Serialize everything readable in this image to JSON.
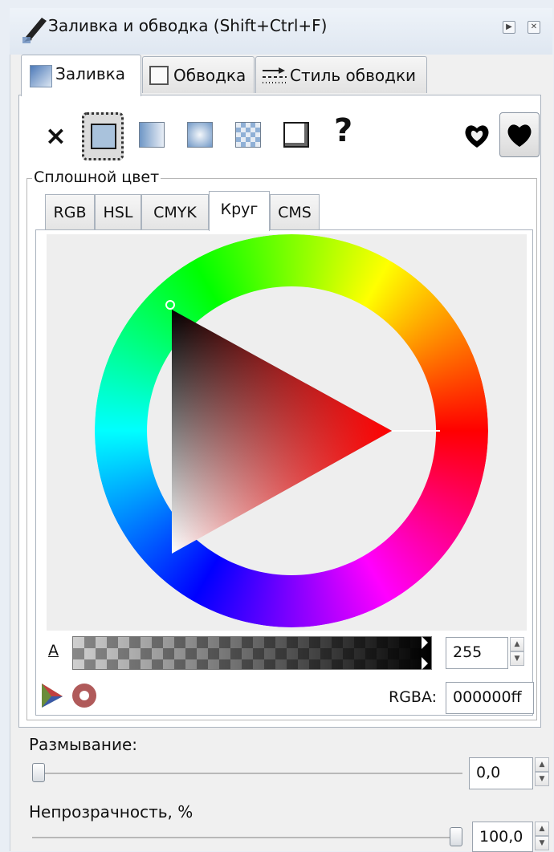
{
  "window": {
    "title": "Заливка и обводка (Shift+Ctrl+F)",
    "buttons": [
      "▶",
      "✕"
    ]
  },
  "tabs": [
    {
      "label": "Заливка",
      "active": true
    },
    {
      "label": "Обводка",
      "active": false
    },
    {
      "label": "Стиль обводки",
      "active": false
    }
  ],
  "paint_buttons": [
    {
      "name": "no-paint",
      "glyph": "×"
    },
    {
      "name": "flat-color",
      "selected": true
    },
    {
      "name": "linear-gradient"
    },
    {
      "name": "radial-gradient"
    },
    {
      "name": "pattern"
    },
    {
      "name": "swatch"
    },
    {
      "name": "unset",
      "glyph": "?"
    }
  ],
  "fill_rule_buttons": [
    {
      "name": "evenodd-icon",
      "selected": false
    },
    {
      "name": "nonzero-icon",
      "selected": true
    }
  ],
  "solid_color": {
    "frame_label": "Сплошной цвет",
    "color_tabs": [
      {
        "label": "RGB"
      },
      {
        "label": "HSL"
      },
      {
        "label": "CMYK"
      },
      {
        "label": "Круг",
        "active": true
      },
      {
        "label": "CMS"
      }
    ],
    "alpha_label": "А",
    "alpha_value": "255",
    "rgba_label": "RGBA:",
    "rgba_value": "000000ff"
  },
  "blur": {
    "label": "Размывание:",
    "value": "0,0",
    "level": 0.0
  },
  "opacity": {
    "label": "Непрозрачность, %",
    "value": "100,0",
    "level": 1.0
  },
  "colors": {
    "current_color": "#000000",
    "wheel_hue": "#ff0000",
    "swatch_fill": "#a9c2dc"
  }
}
